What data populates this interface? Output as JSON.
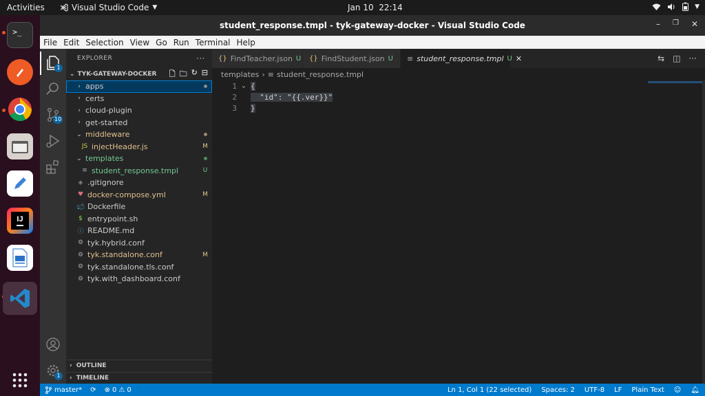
{
  "topbar": {
    "activities": "Activities",
    "app_name": "Visual Studio Code",
    "date": "Jan 10",
    "time": "22:14",
    "tray_icons": [
      "wifi-icon",
      "volume-icon",
      "battery-icon",
      "power-menu-icon"
    ]
  },
  "dock": {
    "items": [
      "terminal",
      "postman",
      "chrome",
      "files",
      "text-editor",
      "intellij",
      "libreoffice-writer",
      "vscode"
    ],
    "accent_color": "#e95420"
  },
  "window": {
    "title": "student_response.tmpl - tyk-gateway-docker - Visual Studio Code"
  },
  "menu": [
    "File",
    "Edit",
    "Selection",
    "View",
    "Go",
    "Run",
    "Terminal",
    "Help"
  ],
  "activity_bar": {
    "explorer_badge": "1",
    "scm_badge": "10",
    "settings_badge": "1"
  },
  "explorer": {
    "header": "EXPLORER",
    "root": "TYK-GATEWAY-DOCKER",
    "tree": [
      {
        "name": "apps",
        "type": "folder",
        "indent": 1,
        "status": "dot",
        "color": "plain",
        "selected": true
      },
      {
        "name": "certs",
        "type": "folder",
        "indent": 1,
        "status": "",
        "color": "plain"
      },
      {
        "name": "cloud-plugin",
        "type": "folder",
        "indent": 1,
        "status": "",
        "color": "plain"
      },
      {
        "name": "get-started",
        "type": "folder",
        "indent": 1,
        "status": "",
        "color": "plain"
      },
      {
        "name": "middleware",
        "type": "folder-open",
        "indent": 1,
        "status": "dot",
        "color": "mod"
      },
      {
        "name": "injectHeader.js",
        "type": "js",
        "indent": 2,
        "status": "M",
        "color": "mod"
      },
      {
        "name": "templates",
        "type": "folder-open",
        "indent": 1,
        "status": "dot-green",
        "color": "unt"
      },
      {
        "name": "student_response.tmpl",
        "type": "text",
        "indent": 2,
        "status": "U",
        "color": "unt"
      },
      {
        "name": ".gitignore",
        "type": "git",
        "indent": 1,
        "status": "",
        "color": "plain"
      },
      {
        "name": "docker-compose.yml",
        "type": "yaml",
        "indent": 1,
        "status": "M",
        "color": "mod"
      },
      {
        "name": "Dockerfile",
        "type": "docker",
        "indent": 1,
        "status": "",
        "color": "plain"
      },
      {
        "name": "entrypoint.sh",
        "type": "shell",
        "indent": 1,
        "status": "",
        "color": "plain"
      },
      {
        "name": "README.md",
        "type": "info",
        "indent": 1,
        "status": "",
        "color": "plain"
      },
      {
        "name": "tyk.hybrid.conf",
        "type": "gear",
        "indent": 1,
        "status": "",
        "color": "plain"
      },
      {
        "name": "tyk.standalone.conf",
        "type": "gear",
        "indent": 1,
        "status": "M",
        "color": "mod"
      },
      {
        "name": "tyk.standalone.tls.conf",
        "type": "gear",
        "indent": 1,
        "status": "",
        "color": "plain"
      },
      {
        "name": "tyk.with_dashboard.conf",
        "type": "gear",
        "indent": 1,
        "status": "",
        "color": "plain"
      }
    ],
    "outline": "OUTLINE",
    "timeline": "TIMELINE"
  },
  "tabs": [
    {
      "name": "FindTeacher.json",
      "status": "U",
      "active": false
    },
    {
      "name": "FindStudent.json",
      "status": "U",
      "active": false,
      "dirty": true
    },
    {
      "name": "student_response.tmpl",
      "status": "U",
      "active": true
    }
  ],
  "breadcrumb": [
    "templates",
    "student_response.tmpl"
  ],
  "editor": {
    "lines": [
      {
        "num": "1",
        "text": "{"
      },
      {
        "num": "2",
        "text": "  \"id\": \"{{.ver}}\""
      },
      {
        "num": "3",
        "text": "}"
      }
    ]
  },
  "statusbar": {
    "branch": "master*",
    "errors": "0",
    "warnings": "0",
    "cursor": "Ln 1, Col 1 (22 selected)",
    "spaces": "Spaces: 2",
    "encoding": "UTF-8",
    "eol": "LF",
    "language": "Plain Text",
    "color": "#007acc"
  }
}
